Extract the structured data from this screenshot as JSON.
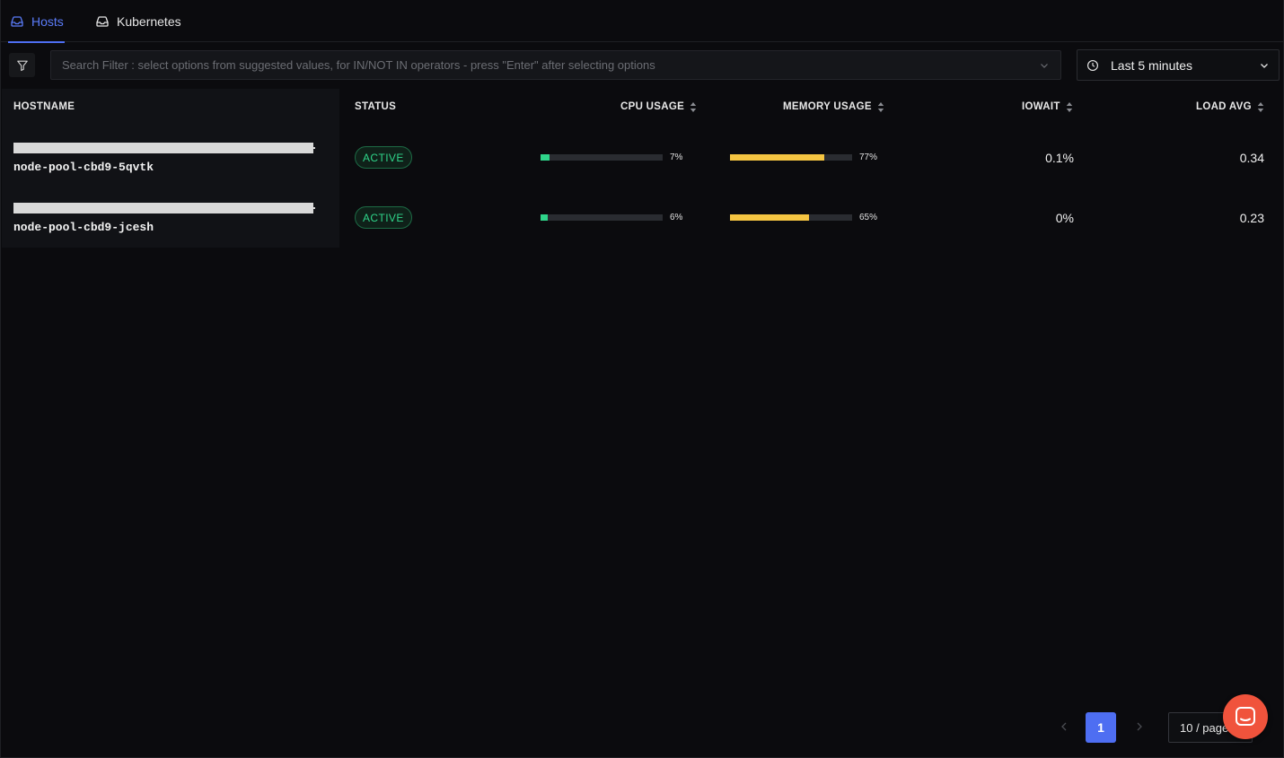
{
  "tabs": [
    {
      "label": "Hosts",
      "icon": "inbox-icon",
      "active": true
    },
    {
      "label": "Kubernetes",
      "icon": "inbox-icon",
      "active": false
    }
  ],
  "filter": {
    "placeholder": "Search Filter : select options from suggested values, for IN/NOT IN operators - press \"Enter\" after selecting options"
  },
  "time_range": {
    "label": "Last 5 minutes"
  },
  "table": {
    "columns": {
      "hostname": "HOSTNAME",
      "status": "STATUS",
      "cpu": "CPU USAGE",
      "memory": "MEMORY USAGE",
      "iowait": "IOWAIT",
      "load": "LOAD AVG"
    },
    "rows": [
      {
        "hostname": "node-pool-cbd9-5qvtk",
        "status": "ACTIVE",
        "cpu_pct": 7,
        "cpu_label": "7%",
        "mem_pct": 77,
        "mem_label": "77%",
        "iowait": "0.1%",
        "load": "0.34"
      },
      {
        "hostname": "node-pool-cbd9-jcesh",
        "status": "ACTIVE",
        "cpu_pct": 6,
        "cpu_label": "6%",
        "mem_pct": 65,
        "mem_label": "65%",
        "iowait": "0%",
        "load": "0.23"
      }
    ]
  },
  "pagination": {
    "current": "1",
    "page_size": "10 / page"
  },
  "colors": {
    "accent": "#4e6ef2",
    "cpu_bar": "#2fd58a",
    "memory_bar": "#f5c542",
    "status_active": "#2fd58a",
    "chat": "#f0533c"
  }
}
